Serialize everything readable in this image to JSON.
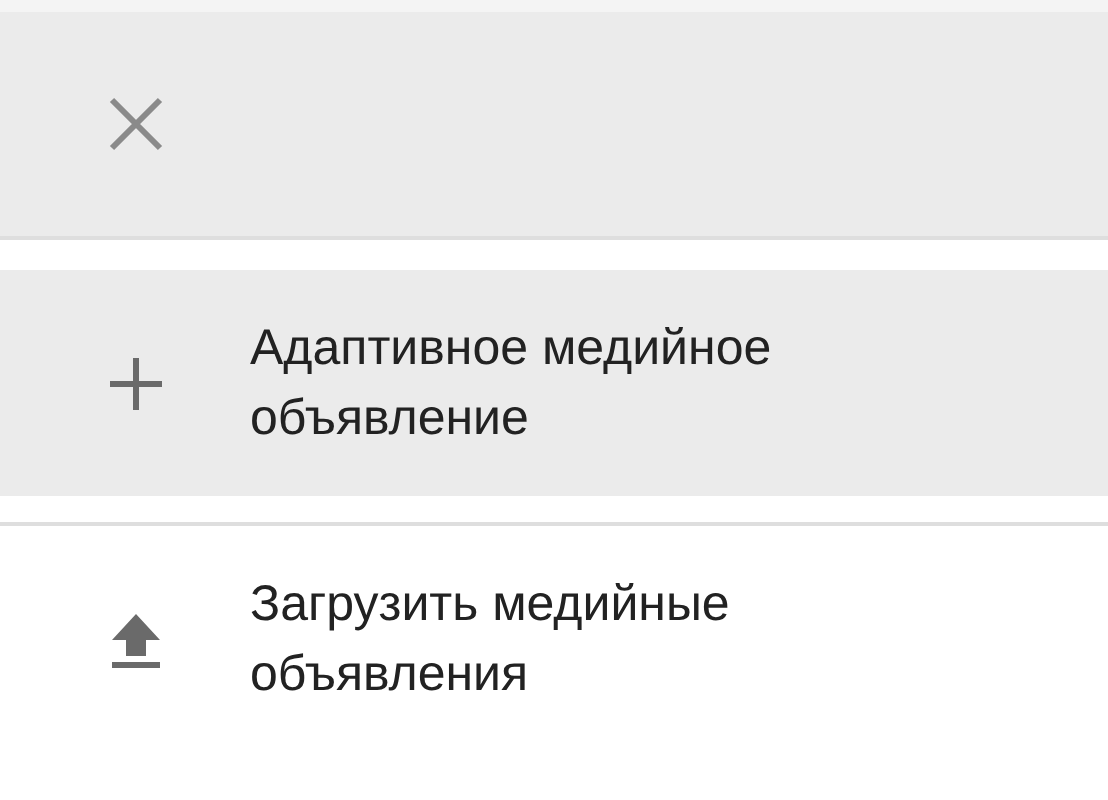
{
  "items": [
    {
      "kind": "add",
      "label": "Адаптивное медийное объявление",
      "selected": true
    },
    {
      "kind": "upload",
      "label": "Загрузить медийные объявления",
      "selected": false
    }
  ]
}
